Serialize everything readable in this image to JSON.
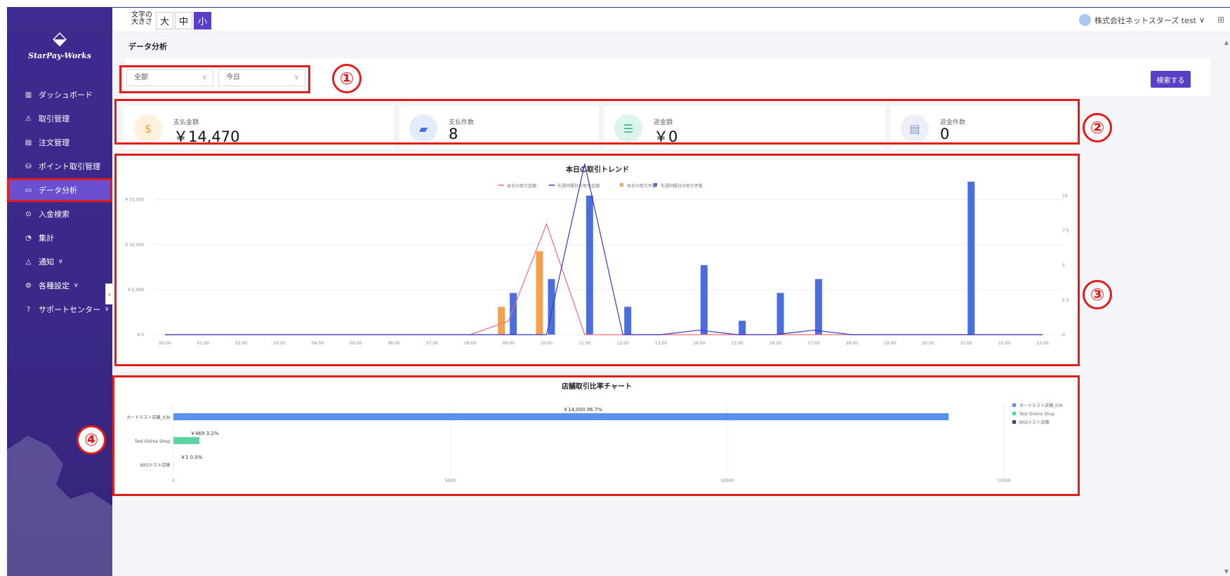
{
  "app": {
    "logo_text": "StarPay-Works"
  },
  "sidebar": {
    "items": [
      {
        "label": "ダッシュボード",
        "icon": "bar-chart-icon",
        "glyph": "▥",
        "active": false,
        "chevron": false
      },
      {
        "label": "取引管理",
        "icon": "warning-icon",
        "glyph": "⚠",
        "active": false,
        "chevron": false
      },
      {
        "label": "注文管理",
        "icon": "clipboard-icon",
        "glyph": "▤",
        "active": false,
        "chevron": false
      },
      {
        "label": "ポイント取引管理",
        "icon": "database-icon",
        "glyph": "⛁",
        "active": false,
        "chevron": false
      },
      {
        "label": "データ分析",
        "icon": "monitor-icon",
        "glyph": "▭",
        "active": true,
        "chevron": false
      },
      {
        "label": "入金検索",
        "icon": "yen-circle-icon",
        "glyph": "⊙",
        "active": false,
        "chevron": false
      },
      {
        "label": "集計",
        "icon": "pie-chart-icon",
        "glyph": "◔",
        "active": false,
        "chevron": false
      },
      {
        "label": "通知",
        "icon": "bell-icon",
        "glyph": "△",
        "active": false,
        "chevron": true
      },
      {
        "label": "各種設定",
        "icon": "settings-icon",
        "glyph": "⚙",
        "active": false,
        "chevron": true
      },
      {
        "label": "サポートセンター",
        "icon": "help-icon",
        "glyph": "?",
        "active": false,
        "chevron": true
      }
    ],
    "collapse_glyph": "‹"
  },
  "topbar": {
    "font_size_label": "文字の大きさ",
    "font_sizes": [
      "大",
      "中",
      "小"
    ],
    "selected_font_size": "小",
    "user_name": "株式会社ネットスターズ test",
    "user_chevron": "∨",
    "user_menu_glyph": "⊞"
  },
  "page": {
    "title": "データ分析"
  },
  "filters": {
    "store_select": "全部",
    "period_select": "今日",
    "arrow": "∨",
    "search_button": "検索する"
  },
  "annotations": [
    "①",
    "②",
    "③",
    "④"
  ],
  "stats": [
    {
      "label": "支払金額",
      "value": "￥14,470",
      "icon": "money-bag-icon",
      "glyph": "$",
      "color": "#f5a03c",
      "bg": "#fff1de"
    },
    {
      "label": "支払件数",
      "value": "8",
      "icon": "folder-icon",
      "glyph": "▰",
      "color": "#4a6ee0",
      "bg": "#e4ebfb"
    },
    {
      "label": "返金額",
      "value": "￥0",
      "icon": "refund-icon",
      "glyph": "☰",
      "color": "#2fb38a",
      "bg": "#dcf4ec"
    },
    {
      "label": "返金件数",
      "value": "0",
      "icon": "archive-icon",
      "glyph": "▤",
      "color": "#8793c6",
      "bg": "#eceff8"
    }
  ],
  "colors": {
    "sidebar": "#3f2a8f",
    "accent": "#5b3ec8",
    "annotation_red": "#e21b1b"
  },
  "chart_data": [
    {
      "type": "bar",
      "title": "本日の取引トレンド",
      "categories": [
        "00:00",
        "01:00",
        "02:00",
        "03:00",
        "04:00",
        "05:00",
        "06:00",
        "07:00",
        "08:00",
        "09:00",
        "10:00",
        "11:00",
        "12:00",
        "13:00",
        "14:00",
        "15:00",
        "16:00",
        "17:00",
        "18:00",
        "19:00",
        "20:00",
        "21:00",
        "22:00",
        "23:00"
      ],
      "left_axis": {
        "ticks": [
          "¥ 0",
          "¥ 5,000",
          "¥ 10,000",
          "¥ 15,000"
        ],
        "ylim": [
          0,
          17000
        ]
      },
      "right_axis": {
        "ticks": [
          "0",
          "2.5",
          "5",
          "7.5",
          "10"
        ],
        "ylim": [
          0,
          11
        ]
      },
      "series": [
        {
          "name": "本日の取引金額",
          "kind": "line",
          "axis": "left",
          "color": "#f26b7a",
          "values": [
            0,
            0,
            0,
            0,
            0,
            0,
            0,
            0,
            0,
            1500,
            12300,
            0,
            0,
            0,
            0,
            0,
            0,
            0,
            0,
            0,
            0,
            0,
            0,
            0
          ]
        },
        {
          "name": "先週同曜日の取引金額",
          "kind": "line",
          "axis": "left",
          "color": "#3b35c0",
          "values": [
            0,
            0,
            0,
            0,
            0,
            0,
            0,
            0,
            0,
            0,
            0,
            19000,
            0,
            0,
            500,
            0,
            0,
            500,
            0,
            0,
            0,
            0,
            0,
            0
          ]
        },
        {
          "name": "本日の取引件数",
          "kind": "bar",
          "axis": "right",
          "color": "#f5a04d",
          "values": [
            0,
            0,
            0,
            0,
            0,
            0,
            0,
            0,
            0,
            2,
            6,
            0,
            0,
            0,
            0,
            0,
            0,
            0,
            0,
            0,
            0,
            0,
            0,
            0
          ]
        },
        {
          "name": "先週同曜日の取引件数",
          "kind": "bar",
          "axis": "right",
          "color": "#4a6ee0",
          "values": [
            0,
            0,
            0,
            0,
            0,
            0,
            0,
            0,
            0,
            3,
            4,
            10,
            2,
            0,
            5,
            1,
            3,
            4,
            0,
            0,
            0,
            11,
            0,
            0
          ]
        }
      ]
    },
    {
      "type": "bar",
      "orientation": "horizontal",
      "title": "店舗取引比率チャート",
      "categories": [
        "カードテスト店舗_ICN",
        "Test Online Shop",
        "NSSテスト店舗"
      ],
      "values": [
        14000,
        469,
        1
      ],
      "labels": [
        "￥14,000   96.7%",
        "￥469   3.2%",
        "￥1   0.0%"
      ],
      "colors": [
        "#5b8ff0",
        "#5ad4a0",
        "#3c3f88"
      ],
      "xlim": [
        0,
        15000
      ],
      "x_ticks": [
        "0",
        "5000",
        "10000",
        "15000"
      ],
      "legend": [
        "カードテスト店舗_ICN",
        "Test Online Shop",
        "NSSテスト店舗"
      ]
    }
  ]
}
